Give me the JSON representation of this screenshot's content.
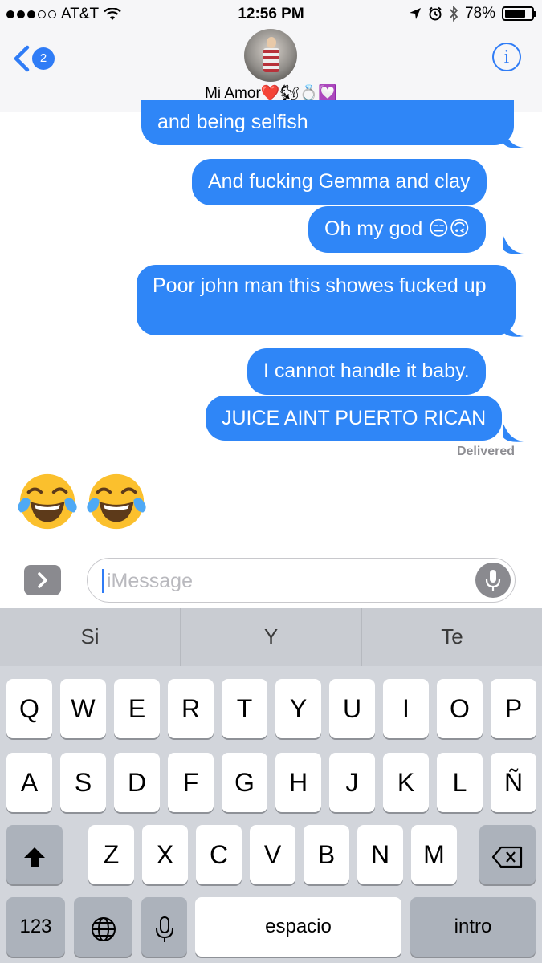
{
  "status_bar": {
    "carrier": "AT&T",
    "time": "12:56 PM",
    "battery": "78%",
    "battery_level": 0.78
  },
  "header": {
    "back_badge": "2",
    "contact_name": "Mi Amor❤️🐿💍💟",
    "info_icon": "i"
  },
  "messages": [
    {
      "text": "and being selfish"
    },
    {
      "text": "And fucking Gemma and clay"
    },
    {
      "text": "Oh my god 😑🙃"
    },
    {
      "text": "Poor john man this showes fucked up"
    },
    {
      "text": "I cannot handle it baby."
    },
    {
      "text": "JUICE AINT PUERTO RICAN"
    }
  ],
  "delivered_label": "Delivered",
  "received": {
    "emoji": [
      "face-with-tears-of-joy",
      "face-with-tears-of-joy"
    ]
  },
  "input": {
    "placeholder": "iMessage"
  },
  "keyboard": {
    "predictions": [
      "Si",
      "Y",
      "Te"
    ],
    "row1": [
      "Q",
      "W",
      "E",
      "R",
      "T",
      "Y",
      "U",
      "I",
      "O",
      "P"
    ],
    "row2": [
      "A",
      "S",
      "D",
      "F",
      "G",
      "H",
      "J",
      "K",
      "L",
      "Ñ"
    ],
    "row3": [
      "Z",
      "X",
      "C",
      "V",
      "B",
      "N",
      "M"
    ],
    "numbers_label": "123",
    "space_label": "espacio",
    "return_label": "intro"
  }
}
